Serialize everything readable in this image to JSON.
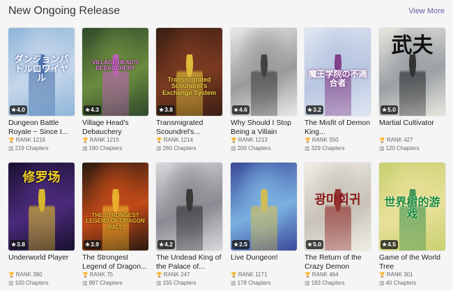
{
  "section": {
    "title": "New Ongoing Release",
    "view_more": "View More"
  },
  "rank_prefix": "RANK",
  "chapters_suffix": "Chapters",
  "novels": [
    {
      "title": "Dungeon Battle Royale ~ Since I...",
      "rating": "4.0",
      "rank": "1216",
      "chapters": "219",
      "cover_text": "ダンジョンバトルロワイヤル"
    },
    {
      "title": "Village Head's Debauchery",
      "rating": "4.3",
      "rank": "1215",
      "chapters": "180",
      "cover_text": "VILLAGE HEAD'S DEBAUCHERY"
    },
    {
      "title": "Transmigrated Scoundrel's...",
      "rating": "3.8",
      "rank": "1214",
      "chapters": "260",
      "cover_text": "Transmigrated Scoundrel's Exchange System"
    },
    {
      "title": "Why Should I Stop Being a Villain",
      "rating": "4.6",
      "rank": "1213",
      "chapters": "200",
      "cover_text": ""
    },
    {
      "title": "The Misfit of Demon King...",
      "rating": "3.2",
      "rank": "550",
      "chapters": "329",
      "cover_text": "魔王学院の不適合者"
    },
    {
      "title": "Martial Cultivator",
      "rating": "5.0",
      "rank": "427",
      "chapters": "120",
      "cover_text": "武夫"
    },
    {
      "title": "Underworld Player",
      "rating": "3.8",
      "rank": "380",
      "chapters": "100",
      "cover_text": "修罗场"
    },
    {
      "title": "The Strongest Legend of Dragon...",
      "rating": "3.9",
      "rank": "75",
      "chapters": "897",
      "cover_text": "THE STRONGEST LEGEND OF DRAGON BALL"
    },
    {
      "title": "The Undead King of the Palace of...",
      "rating": "4.2",
      "rank": "247",
      "chapters": "155",
      "cover_text": ""
    },
    {
      "title": "Live Dungeon!",
      "rating": "2.5",
      "rank": "1171",
      "chapters": "178",
      "cover_text": ""
    },
    {
      "title": "The Return of the Crazy Demon",
      "rating": "5.0",
      "rank": "464",
      "chapters": "193",
      "cover_text": "광마회귀"
    },
    {
      "title": "Game of the World Tree",
      "rating": "4.5",
      "rank": "301",
      "chapters": "40",
      "cover_text": "世界树的游戏"
    }
  ],
  "colors": {
    "accent": "#6a5aa8",
    "covers": [
      [
        "#8fb6d9",
        "#c5d6ea",
        "#3e6aa8"
      ],
      [
        "#2f4a2c",
        "#6b8a3e",
        "#c85cc8"
      ],
      [
        "#3a1e14",
        "#7a3a20",
        "#f0d040"
      ],
      [
        "#e8e8e8",
        "#9a9a9a",
        "#333333"
      ],
      [
        "#dfe6f2",
        "#b8c6e0",
        "#7a2a7a"
      ],
      [
        "#e9e6df",
        "#9aa0a4",
        "#222222"
      ],
      [
        "#1a1030",
        "#4a2a7a",
        "#f0d020"
      ],
      [
        "#2a1a10",
        "#c24a18",
        "#f0c030"
      ],
      [
        "#d8d8dc",
        "#8a8a92",
        "#2a2a2a"
      ],
      [
        "#3a4a9a",
        "#7ab0e0",
        "#e0c040"
      ],
      [
        "#f0ece6",
        "#c8c2b8",
        "#8a1a1a"
      ],
      [
        "#c8d070",
        "#e8e098",
        "#2a8a4a"
      ]
    ]
  }
}
